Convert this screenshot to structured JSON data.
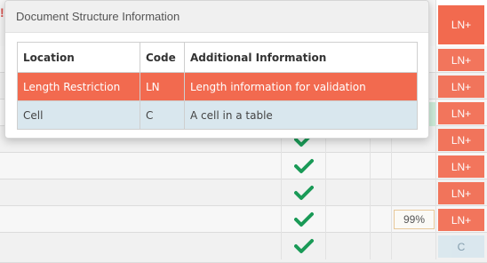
{
  "popover": {
    "title": "Document Structure Information",
    "table": {
      "headers": {
        "location": "Location",
        "code": "Code",
        "info": "Additional Information"
      },
      "rows": [
        {
          "location": "Length Restriction",
          "code": "LN",
          "info": "Length information for validation",
          "highlight": "red"
        },
        {
          "location": "Cell",
          "code": "C",
          "info": "A cell in a table",
          "highlight": "blue"
        }
      ]
    }
  },
  "grid": {
    "header_tag": "LN+",
    "warning_mark": "!",
    "rows": [
      {
        "tag": "LN+",
        "check": false,
        "pct": ""
      },
      {
        "tag": "LN+",
        "check": false,
        "pct": ""
      },
      {
        "tag": "LN+",
        "check": false,
        "pct": ""
      },
      {
        "tag": "LN+",
        "check": true,
        "pct": ""
      },
      {
        "tag": "LN+",
        "check": true,
        "pct": ""
      },
      {
        "tag": "LN+",
        "check": true,
        "pct": ""
      },
      {
        "tag": "LN+",
        "check": true,
        "pct": "99%"
      },
      {
        "tag": "C",
        "check": true,
        "pct": ""
      }
    ]
  },
  "colors": {
    "accent_red": "#f26a4f",
    "info_blue": "#d9e7ee",
    "check_green": "#1a9a57"
  },
  "icons": {
    "check": "check-icon",
    "warning": "warning-icon"
  }
}
